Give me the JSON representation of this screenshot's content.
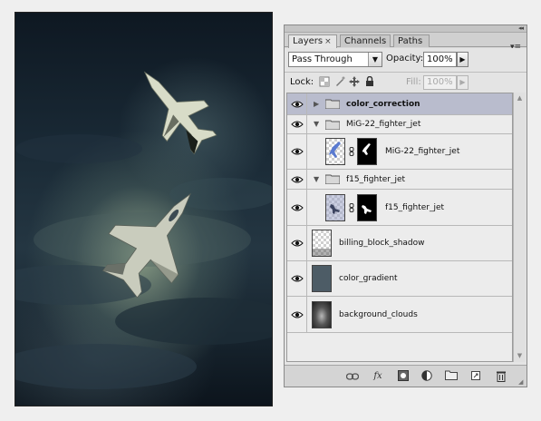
{
  "artwork": {
    "name": "fighter-jets-in-storm"
  },
  "panel": {
    "tabs": [
      {
        "label": "Layers",
        "close": "×",
        "active": true
      },
      {
        "label": "Channels",
        "active": false
      },
      {
        "label": "Paths",
        "active": false
      }
    ],
    "blend_mode": "Pass Through",
    "opacity_label": "Opacity:",
    "opacity_value": "100%",
    "lock_label": "Lock:",
    "fill_label": "Fill:",
    "fill_value": "100%",
    "icons": {
      "collapse": "collapse-icon",
      "menu": "panel-menu-icon",
      "lock_transparency": "lock-transparent-pixels-icon",
      "lock_image": "lock-image-pixels-icon",
      "lock_position": "lock-position-icon",
      "lock_all": "lock-all-icon"
    }
  },
  "layers": [
    {
      "name": "color_correction",
      "type": "group",
      "expanded": false,
      "selected": true,
      "visible": true,
      "bold": true
    },
    {
      "name": "MiG-22_fighter_jet",
      "type": "group",
      "expanded": true,
      "selected": false,
      "visible": true
    },
    {
      "name": "MiG-22_fighter_jet",
      "type": "layer",
      "has_mask": true,
      "selected": false,
      "visible": true,
      "thumb_color": "#5a7ad0"
    },
    {
      "name": "f15_fighter_jet",
      "type": "group",
      "expanded": true,
      "selected": false,
      "visible": true
    },
    {
      "name": "f15_fighter_jet",
      "type": "layer",
      "has_mask": true,
      "selected": false,
      "visible": true,
      "thumb_color": "#9fa6c8"
    },
    {
      "name": "billing_block_shadow",
      "type": "layer",
      "has_mask": false,
      "selected": false,
      "visible": true,
      "thumb_color": "#d0d0d0"
    },
    {
      "name": "color_gradient",
      "type": "layer",
      "has_mask": false,
      "selected": false,
      "visible": true,
      "thumb_color": "#4d5c66"
    },
    {
      "name": "background_clouds",
      "type": "layer",
      "has_mask": false,
      "selected": false,
      "visible": true,
      "thumb_color": "#3a3e42"
    }
  ],
  "footer_buttons": [
    {
      "name": "link-layers-button",
      "glyph": "⛓"
    },
    {
      "name": "layer-style-button",
      "glyph": "fx"
    },
    {
      "name": "add-mask-button",
      "glyph": "◙"
    },
    {
      "name": "new-adjustment-layer-button",
      "glyph": "◐"
    },
    {
      "name": "new-group-button",
      "glyph": "▭"
    },
    {
      "name": "new-layer-button",
      "glyph": "❐"
    },
    {
      "name": "delete-layer-button",
      "glyph": "🗑"
    }
  ],
  "colors": {
    "selected_row": "#b9bccd",
    "panel_bg": "#e4e4e4"
  }
}
